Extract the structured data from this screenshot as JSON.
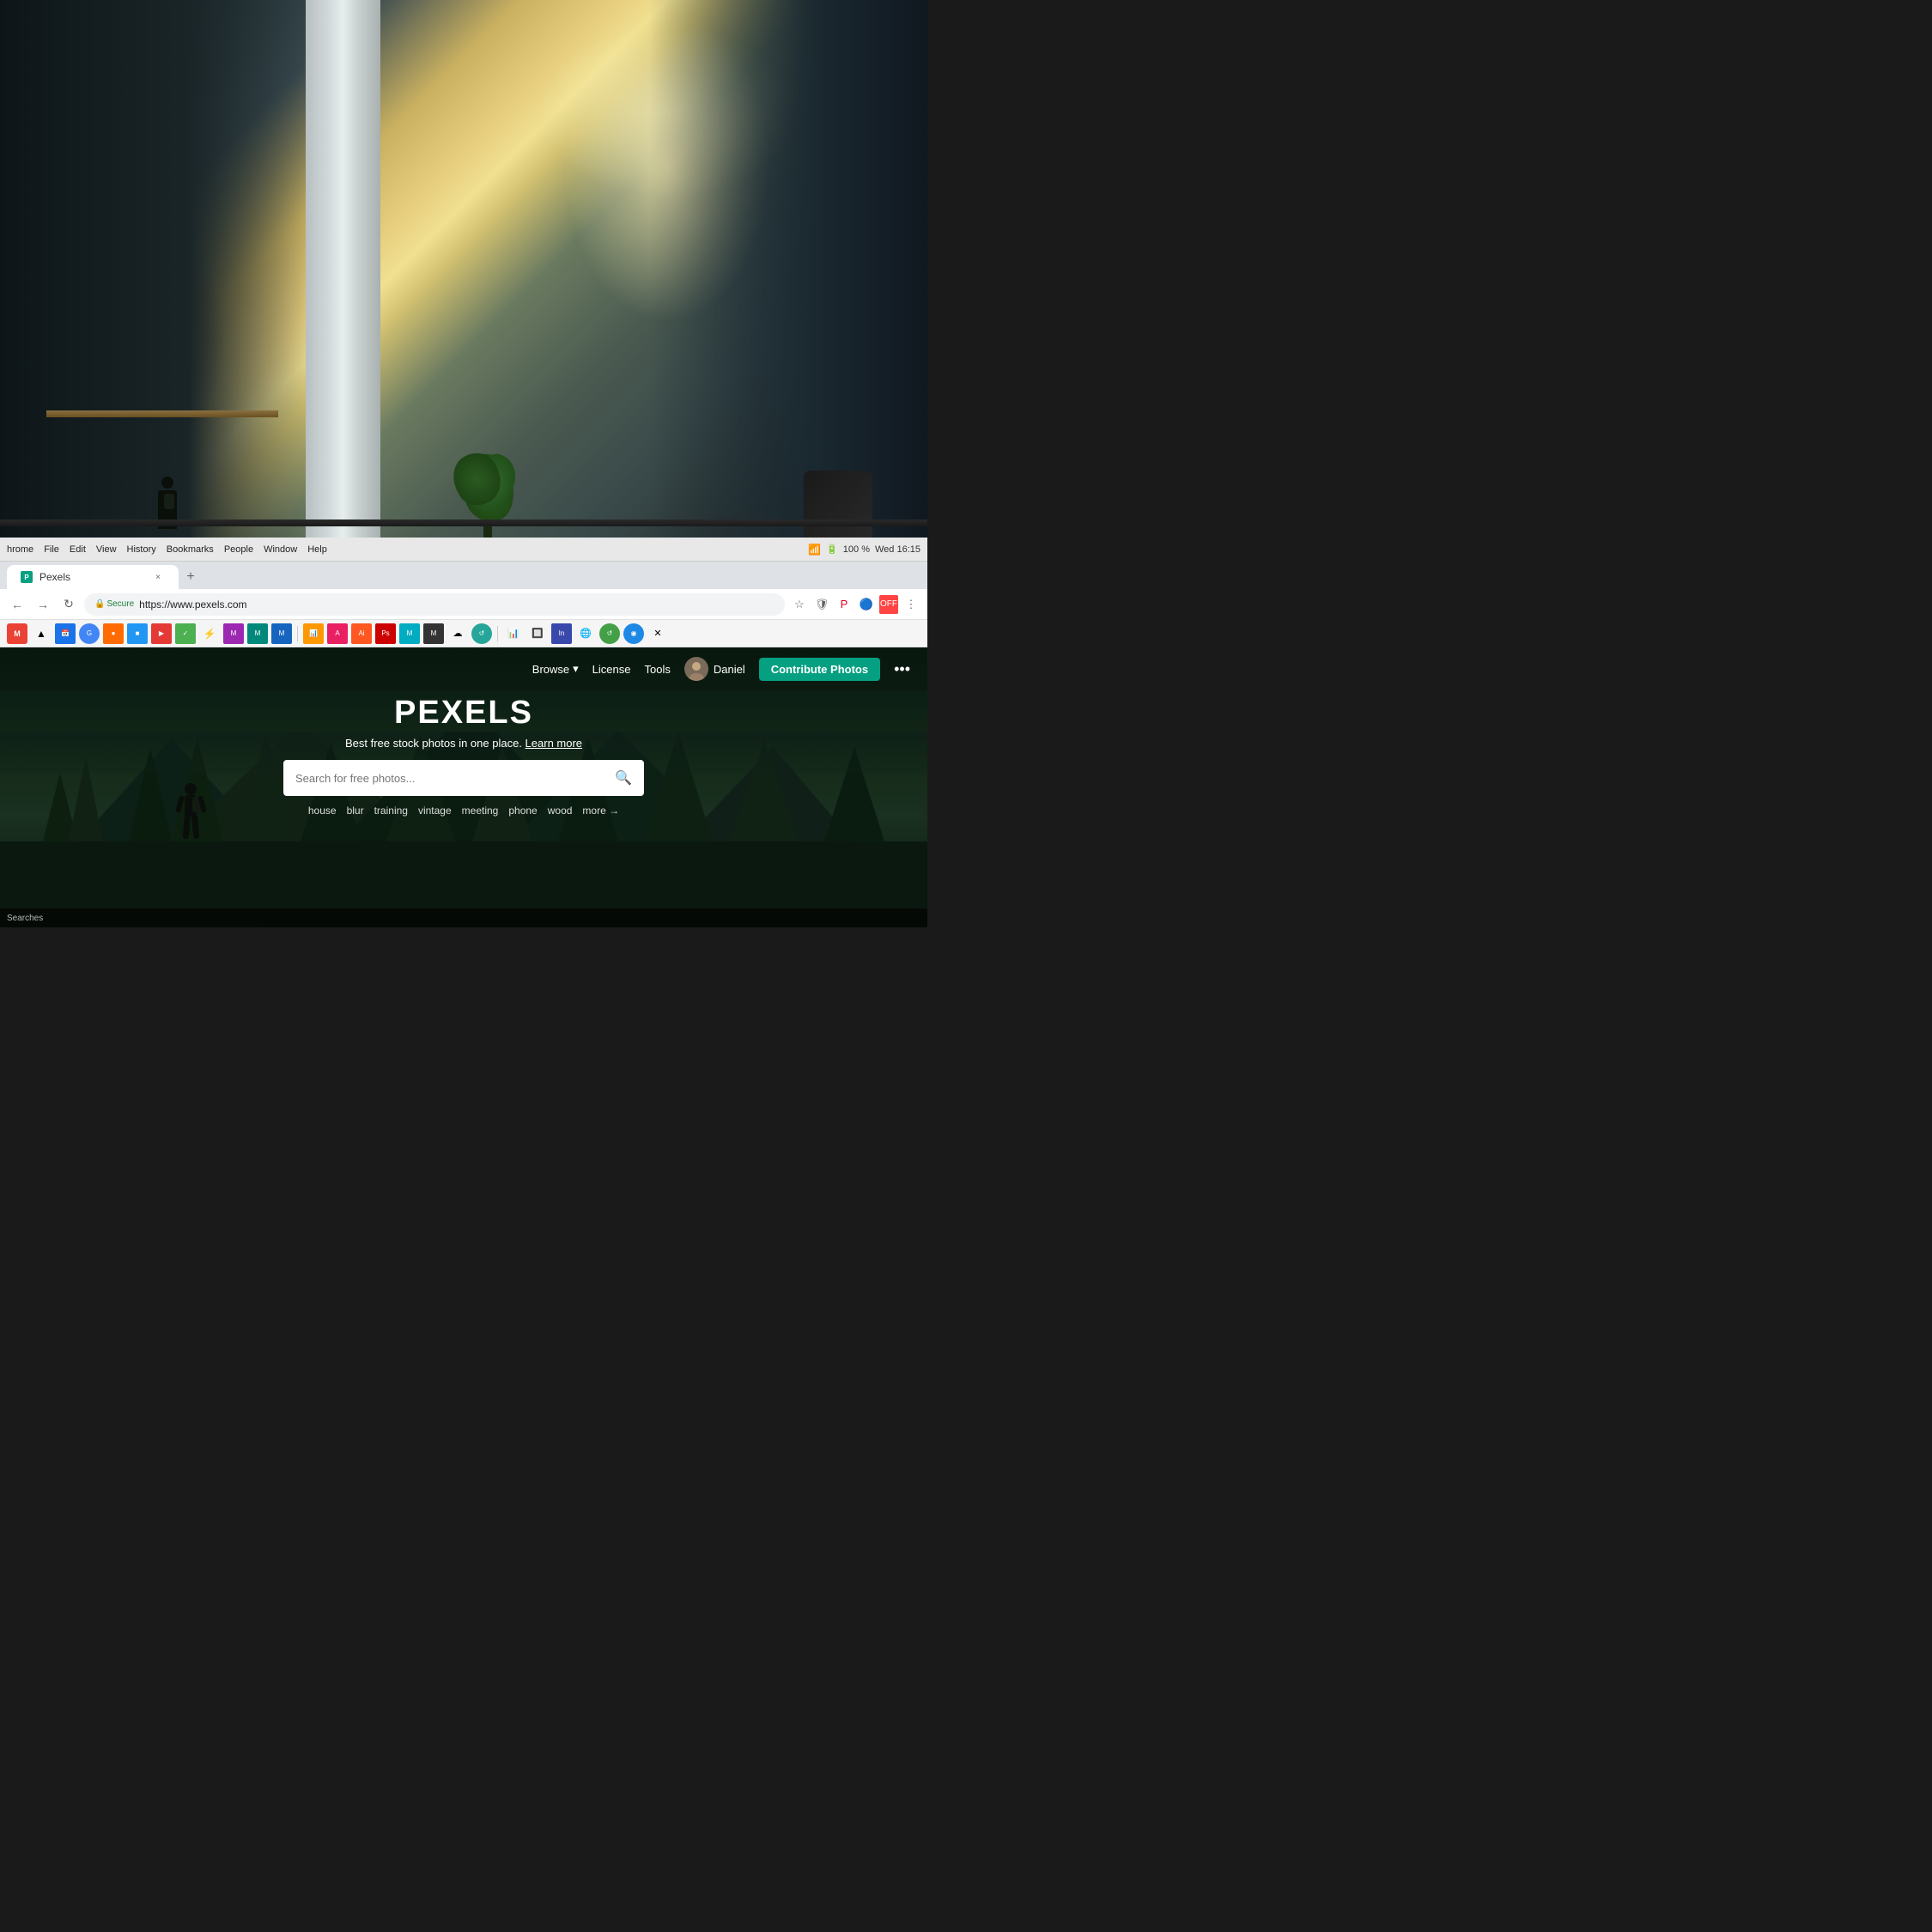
{
  "background": {
    "description": "Office interior with blurred bokeh background, bright window light, plants"
  },
  "os_bar": {
    "menu_items": [
      "hrome",
      "File",
      "Edit",
      "View",
      "History",
      "Bookmarks",
      "People",
      "Window",
      "Help"
    ],
    "time": "Wed 16:15",
    "battery": "100 %",
    "wifi": "WiFi"
  },
  "browser": {
    "tab_title": "Pexels",
    "tab_close": "×",
    "nav": {
      "back": "←",
      "forward": "→",
      "refresh": "↻"
    },
    "url_bar": {
      "secure_label": "Secure",
      "url": "https://www.pexels.com"
    }
  },
  "pexels": {
    "nav": {
      "browse_label": "Browse",
      "browse_arrow": "▾",
      "license_label": "License",
      "tools_label": "Tools",
      "user_name": "Daniel",
      "contribute_label": "Contribute Photos",
      "more_label": "•••"
    },
    "hero": {
      "title": "PEXELS",
      "subtitle": "Best free stock photos in one place.",
      "learn_more": "Learn more",
      "search_placeholder": "Search for free photos...",
      "search_icon": "🔍",
      "tags": [
        "house",
        "blur",
        "training",
        "vintage",
        "meeting",
        "phone",
        "wood"
      ],
      "more_tag": "more →"
    }
  },
  "taskbar": {
    "label": "Searches"
  }
}
